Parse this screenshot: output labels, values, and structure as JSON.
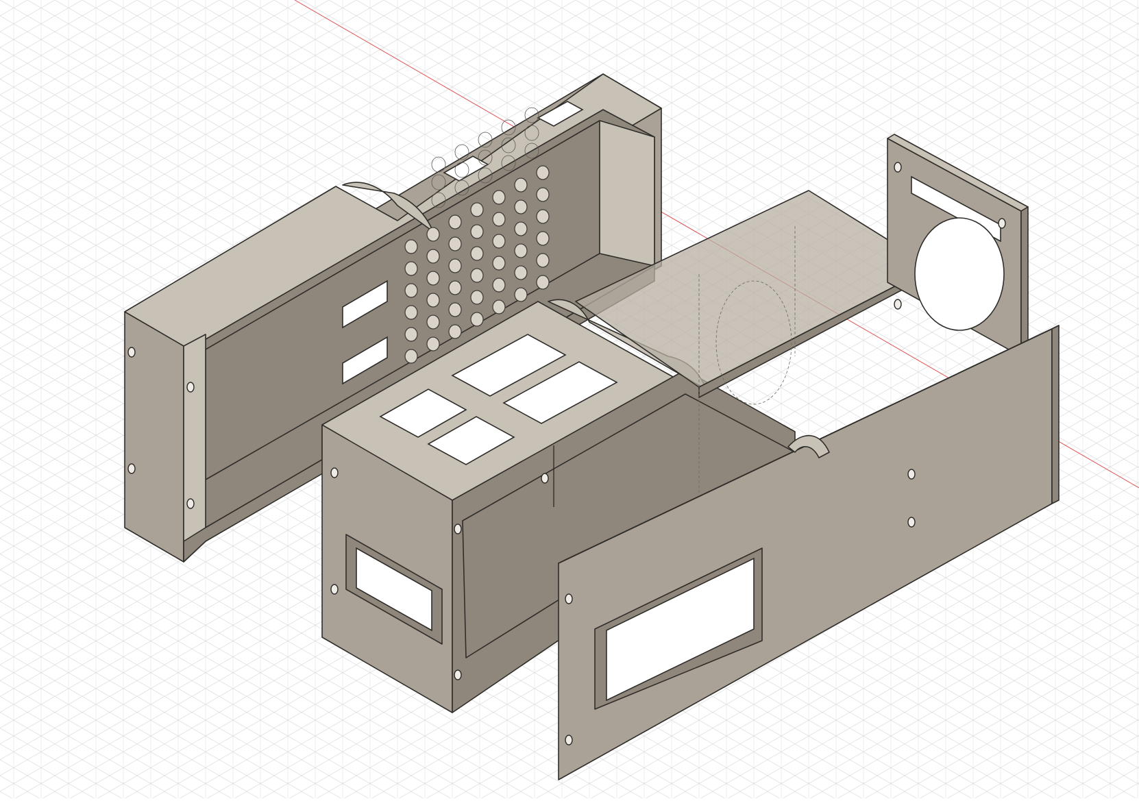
{
  "viewport": {
    "background": "#ffffff",
    "grid_color": "#d6d6d6",
    "grid_major_color": "#bdbdbd",
    "axis_color": "#e05050"
  },
  "model": {
    "colors": {
      "body": "#aaa296",
      "body_light": "#c8c1b6",
      "body_dark": "#8f877b",
      "body_translucent": "#b7afa3",
      "edge": "#2f2d2a"
    },
    "parts": [
      {
        "name": "left-shell"
      },
      {
        "name": "center-chassis"
      },
      {
        "name": "top-plate"
      },
      {
        "name": "fan-bracket"
      },
      {
        "name": "front-panel"
      }
    ]
  }
}
